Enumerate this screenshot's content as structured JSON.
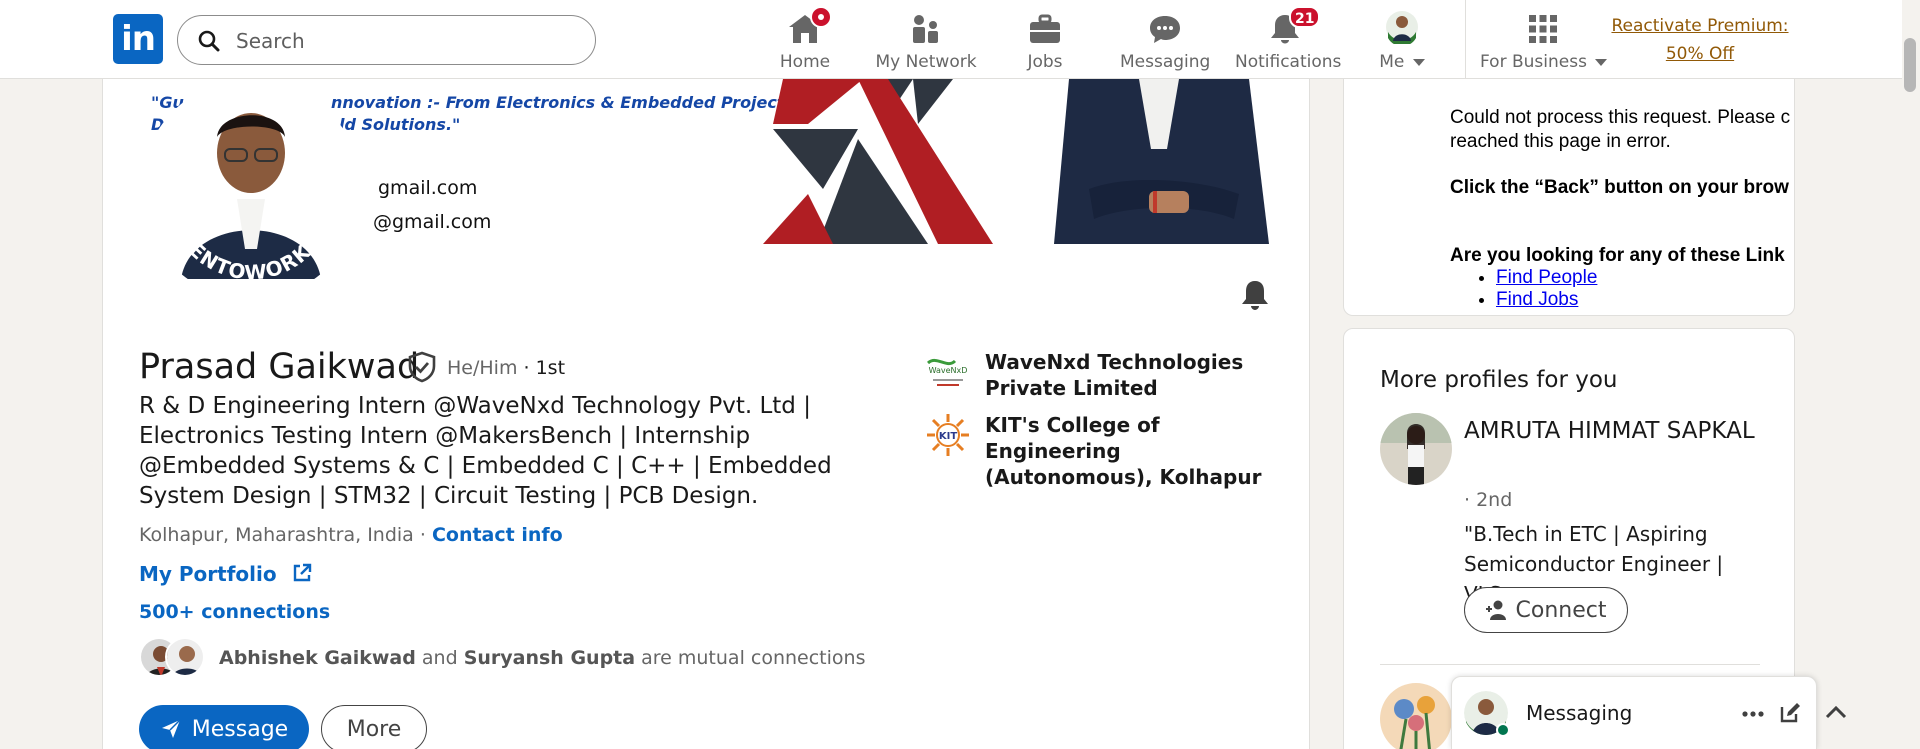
{
  "nav": {
    "logo_text": "in",
    "search_placeholder": "Search",
    "items": [
      {
        "label": "Home",
        "icon": "home-icon"
      },
      {
        "label": "My Network",
        "icon": "network-icon"
      },
      {
        "label": "Jobs",
        "icon": "briefcase-icon"
      },
      {
        "label": "Messaging",
        "icon": "chat-icon"
      },
      {
        "label": "Notifications",
        "icon": "bell-icon",
        "badge": "21"
      },
      {
        "label": "Me",
        "icon": "avatar-icon"
      },
      {
        "label": "For Business",
        "icon": "grid-icon"
      }
    ],
    "premium_line1": "Reactivate Premium:",
    "premium_line2": "50% Off"
  },
  "banner": {
    "quote_line1": "\"Gu",
    "quote_line1b": "nnovation :- From Electronics & Embedded Project",
    "quote_line2": "D",
    "quote_line2b": "ld Solutions.\"",
    "email1": "gmail.com",
    "email2": "@gmail.com",
    "frame_text": "#OPENTOWORK"
  },
  "profile": {
    "name": "Prasad Gaikwad",
    "pronouns": "He/Him",
    "degree": "· 1st",
    "headline": "R & D Engineering Intern @WaveNxd Technology Pvt. Ltd | Electronics Testing Intern @MakersBench | Internship @Embedded Systems & C | Embedded C | C++ | Embedded System Design | STM32 | Circuit Testing | PCB Design.",
    "location": "Kolhapur, Maharashtra, India",
    "location_sep": " · ",
    "contact_info": "Contact info",
    "portfolio": "My Portfolio",
    "connections": "500+ connections",
    "mutual_name1": "Abhishek Gaikwad",
    "mutual_and": " and ",
    "mutual_name2": "Suryansh Gupta",
    "mutual_suffix": " are mutual connections",
    "message_button": "Message",
    "more_button": "More",
    "experience": [
      {
        "name": "WaveNxd Technologies Private Limited",
        "logo_text": "WaveNxD"
      },
      {
        "name": "KIT's College of Engineering (Autonomous), Kolhapur",
        "logo_text": "KIT"
      }
    ]
  },
  "error_panel": {
    "line1": "Could not process this request. Please c",
    "line2": "reached this page in error.",
    "line3": "Click the “Back” button on your brow",
    "line4": "Are you looking for any of these Link",
    "links": [
      "Find People",
      "Find Jobs"
    ]
  },
  "more_profiles": {
    "title": "More profiles for you",
    "name": "AMRUTA HIMMAT SAPKAL",
    "degree": "· 2nd",
    "headline": "\"B.Tech in ETC | Aspiring Semiconductor Engineer | VLS...",
    "connect_button": "Connect"
  },
  "messaging": {
    "title": "Messaging"
  },
  "colors": {
    "brand": "#0a66c2",
    "badge": "#cb112d",
    "premium": "#915907",
    "opentowork": "#2f7a33"
  }
}
